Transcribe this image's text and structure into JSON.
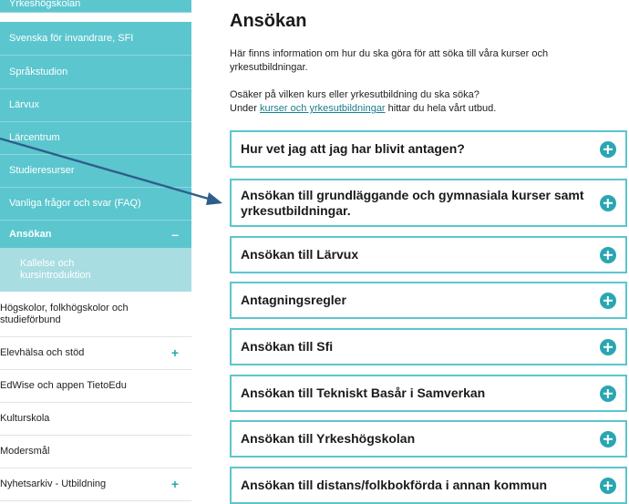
{
  "sidebar": {
    "items": [
      {
        "label": "Yrkeshögskolan"
      },
      {
        "label": "Svenska för invandrare, SFI"
      },
      {
        "label": "Språkstudion"
      },
      {
        "label": "Lärvux"
      },
      {
        "label": "Lärcentrum"
      },
      {
        "label": "Studieresurser"
      },
      {
        "label": "Vanliga frågor och svar (FAQ)"
      },
      {
        "label": "Ansökan",
        "toggle": "–"
      },
      {
        "label": "Kallelse och kursintroduktion"
      },
      {
        "label": "Högskolor, folkhögskolor och studieförbund"
      },
      {
        "label": "Elevhälsa och stöd",
        "toggle": "+"
      },
      {
        "label": "EdWise och appen TietoEdu"
      },
      {
        "label": "Kulturskola"
      },
      {
        "label": "Modersmål"
      },
      {
        "label": "Nyhetsarkiv - Utbildning",
        "toggle": "+"
      }
    ]
  },
  "main": {
    "title": "Ansökan",
    "intro": "Här finns information om hur du ska göra för att söka till våra kurser och yrkesutbildningar.",
    "intro2_line1": "Osäker på vilken kurs eller yrkesutbildning du ska söka?",
    "intro2_prefix": "Under ",
    "intro2_link": "kurser och yrkesutbildningar",
    "intro2_suffix": " hittar du hela vårt utbud.",
    "accordions": [
      {
        "label": "Hur vet jag att jag har blivit antagen?"
      },
      {
        "label": "Ansökan till grundläggande och gymnasiala kurser samt yrkesutbildningar."
      },
      {
        "label": "Ansökan till Lärvux"
      },
      {
        "label": "Antagningsregler"
      },
      {
        "label": "Ansökan till Sfi"
      },
      {
        "label": "Ansökan till Tekniskt Basår i Samverkan"
      },
      {
        "label": "Ansökan till Yrkeshögskolan"
      },
      {
        "label": "Ansökan till distans/folkbokförda i annan kommun"
      }
    ]
  },
  "colors": {
    "teal": "#5cc6cf",
    "teal_light": "#a8dde2",
    "accent": "#2aa6b3",
    "link": "#1a7f8c",
    "annotation_arrow": "#2e5f8a"
  }
}
